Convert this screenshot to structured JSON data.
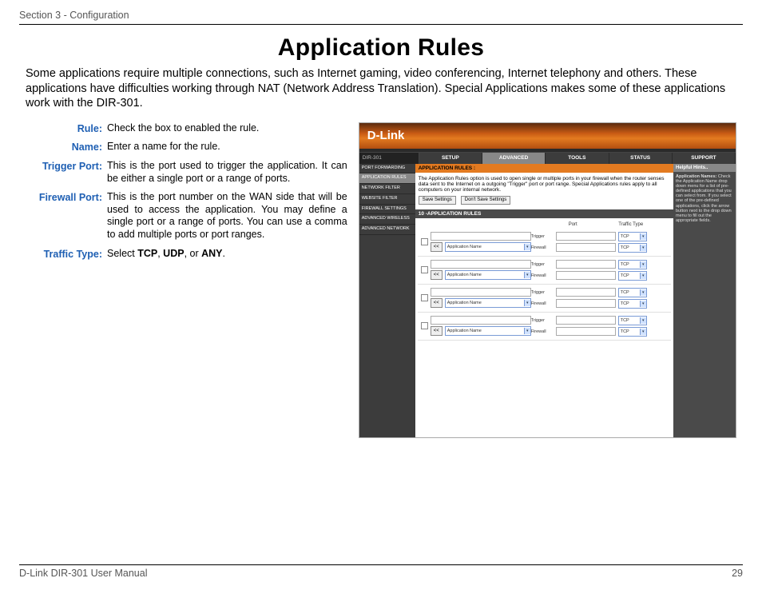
{
  "section_header": "Section 3 - Configuration",
  "title": "Application Rules",
  "intro": "Some applications require multiple connections, such as Internet gaming, video conferencing, Internet telephony and others. These applications have difficulties working through NAT (Network Address Translation). Special Applications makes some of these applications work with the DIR-301.",
  "defs": [
    {
      "label": "Rule:",
      "text": "Check the box to enabled the rule."
    },
    {
      "label": "Name:",
      "text": "Enter a name for the rule."
    },
    {
      "label": "Trigger Port:",
      "text": "This is the port used to trigger the application. It can be either a single port or a range of ports."
    },
    {
      "label": "Firewall Port:",
      "text": "This is the port number on the WAN side that will be used to access the application. You may define a single port or a range of ports. You can use a comma to add multiple ports or port ranges."
    },
    {
      "label": "Traffic Type:",
      "html": "Select <b>TCP</b>, <b>UDP</b>, or <b>ANY</b>."
    }
  ],
  "shot": {
    "brand": "D-Link",
    "model": "DIR-301",
    "tabs": [
      "SETUP",
      "ADVANCED",
      "TOOLS",
      "STATUS",
      "SUPPORT"
    ],
    "active_tab": 1,
    "sidebar": [
      "PORT FORWARDING",
      "APPLICATION RULES",
      "NETWORK FILTER",
      "WEBSITE FILTER",
      "FIREWALL SETTINGS",
      "ADVANCED WIRELESS",
      "ADVANCED NETWORK"
    ],
    "active_side": 1,
    "panel_title": "APPLICATION RULES :",
    "panel_desc": "The Application Rules option is used to open single or multiple ports in your firewall when the router senses data sent to the Internet on a outgoing \"Trigger\" port or port range. Special Applications rules apply to all computers on your internal network.",
    "save_btn": "Save Settings",
    "dont_save_btn": "Don't Save Settings",
    "rules_title": "10 -APPLICATION RULES",
    "col_port": "Port",
    "col_type": "Traffic Type",
    "row_labels": {
      "trigger": "Trigger",
      "firewall": "Firewall"
    },
    "app_dd_label": "Application Name",
    "app_btn": "<<",
    "proto_option": "TCP",
    "hints_title": "Helpful Hints..",
    "hints_body_label": "Application Names:",
    "hints_body": "Check the Application Name drop down menu for a list of pre-defined applications that you can select from. If you select one of the pre-defined applications, click the arrow button next to the drop down menu to fill out the appropriate fields."
  },
  "footer_left": "D-Link DIR-301 User Manual",
  "footer_right": "29"
}
